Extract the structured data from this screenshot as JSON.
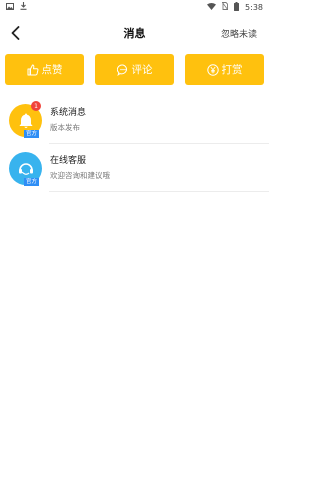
{
  "status_bar": {
    "time": "5:38",
    "icons": [
      "image-icon",
      "download-icon",
      "wifi-icon",
      "no-sim-icon",
      "battery-icon"
    ]
  },
  "header": {
    "title": "消息",
    "ignore_unread": "忽略未读"
  },
  "actions": [
    {
      "label": "点赞",
      "icon": "thumbs-up-icon"
    },
    {
      "label": "评论",
      "icon": "chat-bubble-icon"
    },
    {
      "label": "打赏",
      "icon": "yen-coin-icon"
    }
  ],
  "messages": [
    {
      "title": "系统消息",
      "subtitle": "版本发布",
      "tag": "官方",
      "badge": "1",
      "icon": "bell-icon",
      "color": "#ffc10e"
    },
    {
      "title": "在线客服",
      "subtitle": "欢迎咨询和建议哦",
      "tag": "官方",
      "icon": "customer-service-icon",
      "color": "#38b3ee"
    }
  ],
  "colors": {
    "accent": "#ffc10e",
    "badge": "#f0433a",
    "tag": "#2f8ef5",
    "service": "#38b3ee"
  }
}
